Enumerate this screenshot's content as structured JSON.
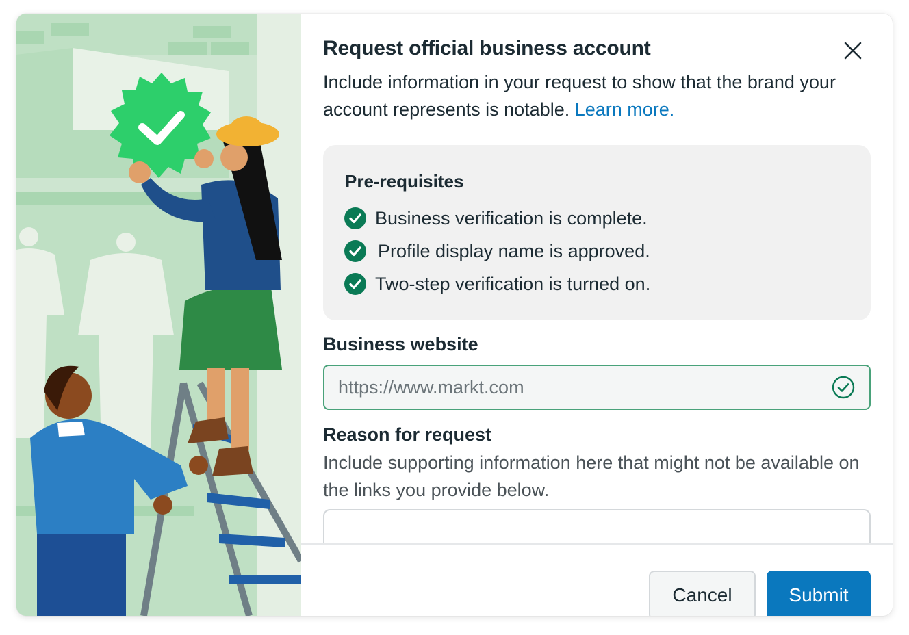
{
  "dialog": {
    "title": "Request official business account",
    "description_text": "Include information in your request to show that the brand your account represents is notable.",
    "learn_more": "Learn more."
  },
  "prerequisites": {
    "title": "Pre-requisites",
    "items": [
      {
        "label": "Business verification is complete.",
        "icon": "check-circle-icon"
      },
      {
        "label": "Profile display name is approved.",
        "icon": "check-circle-icon"
      },
      {
        "label": "Two-step verification is turned on.",
        "icon": "check-circle-icon"
      }
    ]
  },
  "website": {
    "label": "Business website",
    "value": "https://www.markt.com",
    "status_icon": "valid-check-icon"
  },
  "reason": {
    "label": "Reason for request",
    "help": "Include supporting information here that might not be available on the links you provide below.",
    "value": ""
  },
  "footer": {
    "cancel": "Cancel",
    "submit": "Submit"
  },
  "colors": {
    "accent": "#0a78be",
    "success": "#0a7a55",
    "valid_border": "#49a27a",
    "card_bg": "#f1f1f1"
  }
}
